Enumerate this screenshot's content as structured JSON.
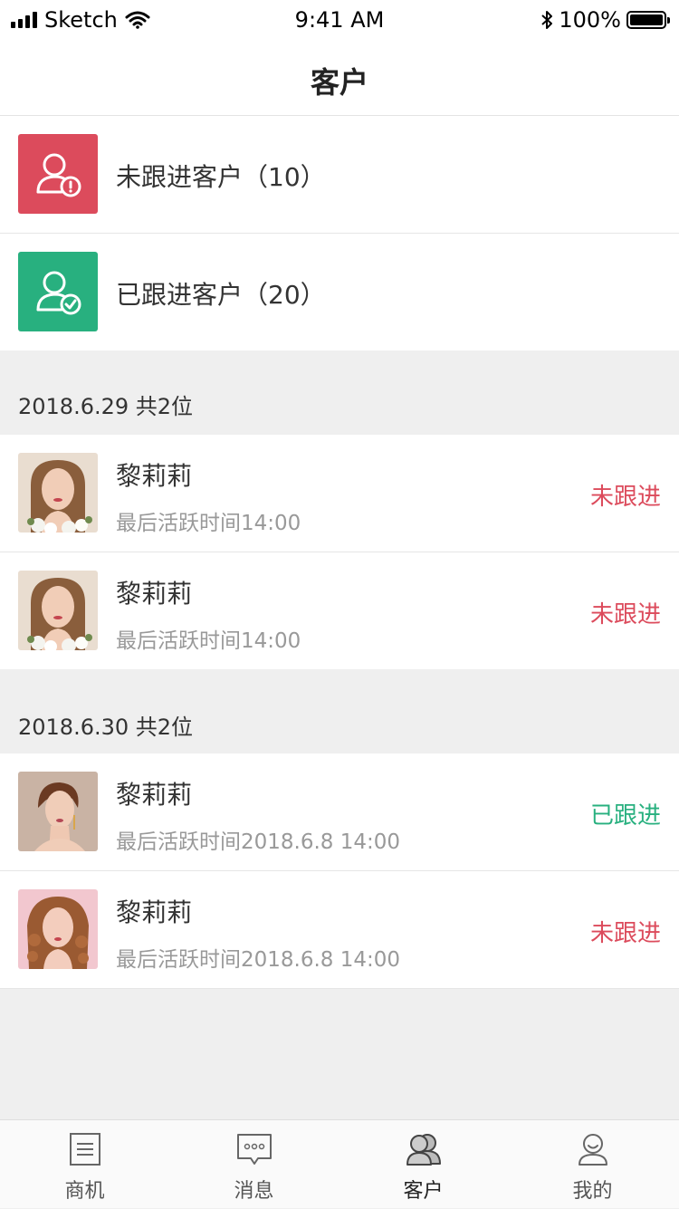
{
  "status_bar": {
    "carrier": "Sketch",
    "time": "9:41 AM",
    "battery": "100%"
  },
  "nav": {
    "title": "客户"
  },
  "categories": [
    {
      "label": "未跟进客户（10）",
      "color": "#dc4b5c",
      "icon": "user-alert-icon"
    },
    {
      "label": "已跟进客户（20）",
      "color": "#28b07f",
      "icon": "user-check-icon"
    }
  ],
  "sections": [
    {
      "header": "2018.6.29 共2位",
      "items": [
        {
          "name": "黎莉莉",
          "active": "最后活跃时间14:00",
          "status": "未跟进"
        },
        {
          "name": "黎莉莉",
          "active": "最后活跃时间14:00",
          "status": "未跟进"
        }
      ]
    },
    {
      "header": "2018.6.30 共2位",
      "items": [
        {
          "name": "黎莉莉",
          "active": "最后活跃时间2018.6.8 14:00",
          "status": "已跟进"
        },
        {
          "name": "黎莉莉",
          "active": "最后活跃时间2018.6.8 14:00",
          "status": "未跟进"
        }
      ]
    }
  ],
  "colors": {
    "not_followed": "#dc4b5c",
    "followed": "#28b07f"
  },
  "tab_bar": [
    {
      "label": "商机",
      "icon": "document-icon"
    },
    {
      "label": "消息",
      "icon": "message-icon"
    },
    {
      "label": "客户",
      "icon": "customer-icon",
      "active": true
    },
    {
      "label": "我的",
      "icon": "profile-icon"
    }
  ]
}
